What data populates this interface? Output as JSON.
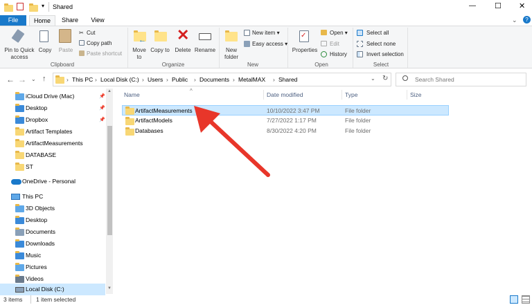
{
  "titlebar": {
    "title": "Shared",
    "minimize": "—",
    "maximize": "☐",
    "close": "✕",
    "expand_ribbon": "⌄",
    "help": "?"
  },
  "tabs": [
    {
      "label": "File"
    },
    {
      "label": "Home"
    },
    {
      "label": "Share"
    },
    {
      "label": "View"
    }
  ],
  "ribbon": {
    "clipboard": {
      "group": "Clipboard",
      "pin": "Pin to Quick access",
      "copy": "Copy",
      "paste": "Paste",
      "cut": "Cut",
      "copy_path": "Copy path",
      "paste_shortcut": "Paste shortcut"
    },
    "organize": {
      "group": "Organize",
      "move_to": "Move to",
      "copy_to": "Copy to",
      "delete": "Delete",
      "rename": "Rename"
    },
    "new": {
      "group": "New",
      "new_folder": "New folder",
      "new_item": "New item ▾",
      "easy_access": "Easy access ▾"
    },
    "open": {
      "group": "Open",
      "properties": "Properties",
      "open": "Open ▾",
      "edit": "Edit",
      "history": "History"
    },
    "select": {
      "group": "Select",
      "select_all": "Select all",
      "select_none": "Select none",
      "invert": "Invert selection"
    }
  },
  "address": {
    "crumbs": [
      "This PC",
      "Local Disk (C:)",
      "Users",
      "Public",
      "Documents",
      "MetalMAX",
      "Shared"
    ],
    "separator": "›",
    "search_placeholder": "Search Shared"
  },
  "nav": {
    "quick": [
      {
        "label": "iCloud Drive (Mac)",
        "pinned": true
      },
      {
        "label": "Desktop",
        "pinned": true
      },
      {
        "label": "Dropbox",
        "pinned": true
      },
      {
        "label": "Artifact Templates",
        "pinned": false
      },
      {
        "label": "ArtifactMeasurements",
        "pinned": false
      },
      {
        "label": "DATABASE",
        "pinned": false
      },
      {
        "label": "ST",
        "pinned": false
      }
    ],
    "onedrive": "OneDrive - Personal",
    "thispc": "This PC",
    "pc_items": [
      "3D Objects",
      "Desktop",
      "Documents",
      "Downloads",
      "Music",
      "Pictures",
      "Videos",
      "Local Disk (C:)"
    ],
    "pin_glyph": "📌"
  },
  "columns": {
    "name": "Name",
    "date": "Date modified",
    "type": "Type",
    "size": "Size"
  },
  "files": [
    {
      "name": "ArtifactMeasurements",
      "date": "10/10/2022 3:47 PM",
      "type": "File folder",
      "selected": true
    },
    {
      "name": "ArtifactModels",
      "date": "7/27/2022 1:17 PM",
      "type": "File folder",
      "selected": false
    },
    {
      "name": "Databases",
      "date": "8/30/2022 4:20 PM",
      "type": "File folder",
      "selected": false
    }
  ],
  "status": {
    "count": "3 items",
    "selected": "1 item selected"
  },
  "colors": {
    "accent": "#1979ca",
    "selection": "#cce8ff",
    "arrow": "#e8362a"
  }
}
